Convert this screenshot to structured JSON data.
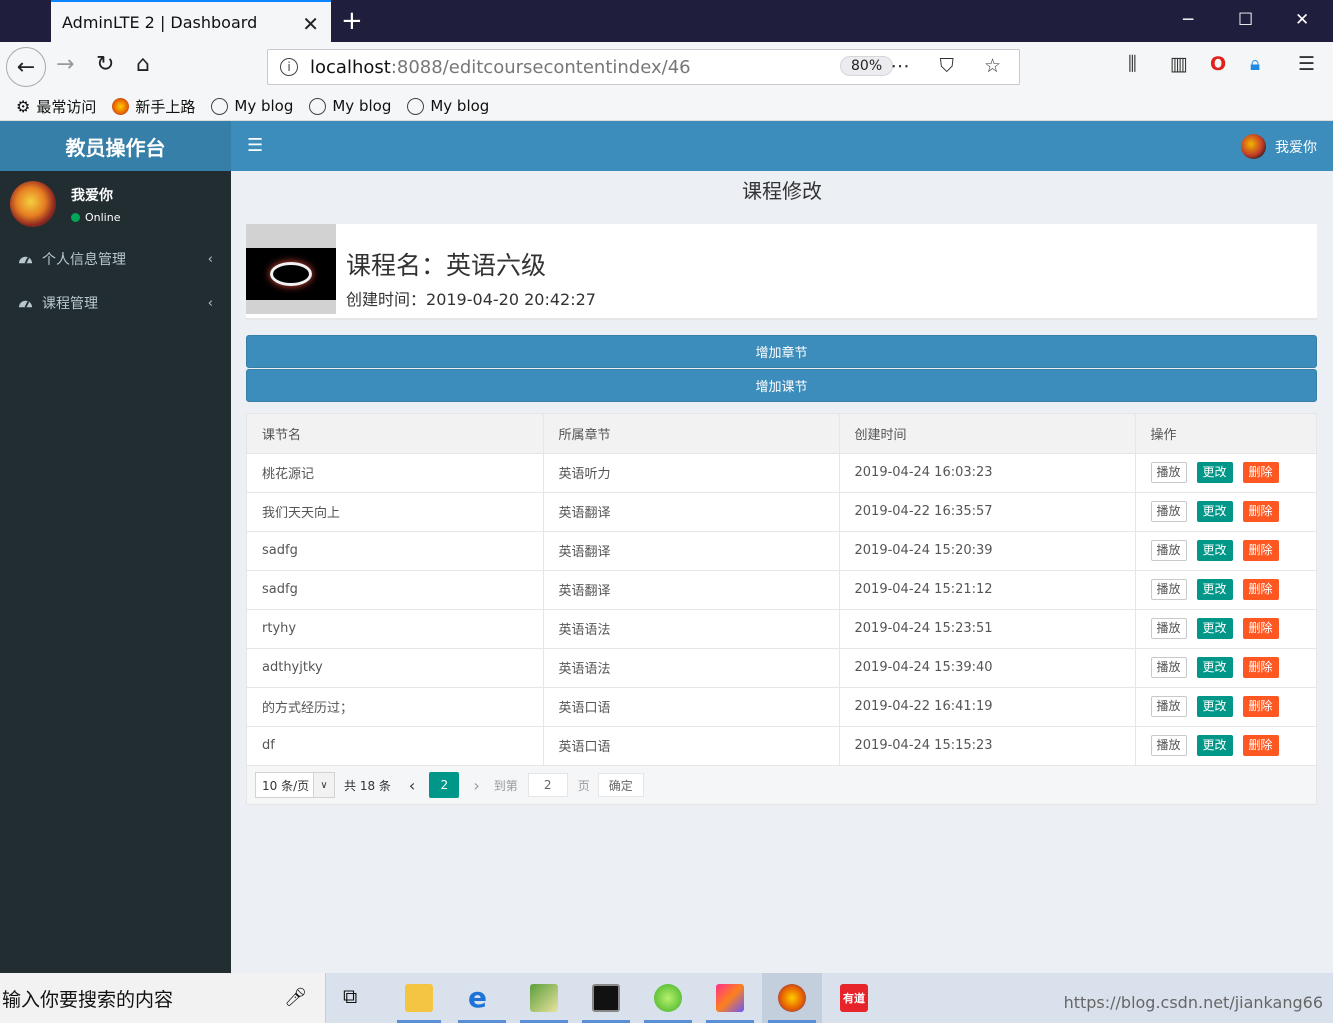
{
  "browser": {
    "tab_title": "AdminLTE 2 | Dashboard",
    "url_host": "localhost",
    "url_path": ":8088/editcoursecontentindex/46",
    "zoom": "80%",
    "bookmarks": [
      "最常访问",
      "新手上路",
      "My blog",
      "My blog",
      "My blog"
    ]
  },
  "app": {
    "logo": "教员操作台",
    "header_user": "我爱你",
    "sidebar": {
      "user_name": "我爱你",
      "status": "Online",
      "items": [
        {
          "label": "个人信息管理"
        },
        {
          "label": "课程管理"
        }
      ]
    },
    "page_title": "课程修改",
    "course": {
      "name": "课程名：英语六级",
      "created_label": "创建时间：",
      "created_value": "2019-04-20 20:42:27"
    },
    "buttons": {
      "add_chapter": "增加章节",
      "add_lesson": "增加课节"
    },
    "table": {
      "headers": [
        "课节名",
        "所属章节",
        "创建时间",
        "操作"
      ],
      "rows": [
        {
          "name": "桃花源记",
          "chapter": "英语听力",
          "time": "2019-04-24 16:03:23"
        },
        {
          "name": "我们天天向上",
          "chapter": "英语翻译",
          "time": "2019-04-22 16:35:57"
        },
        {
          "name": "sadfg",
          "chapter": "英语翻译",
          "time": "2019-04-24 15:20:39"
        },
        {
          "name": "sadfg",
          "chapter": "英语翻译",
          "time": "2019-04-24 15:21:12"
        },
        {
          "name": "rtyhy",
          "chapter": "英语语法",
          "time": "2019-04-24 15:23:51"
        },
        {
          "name": "adthyjtky",
          "chapter": "英语语法",
          "time": "2019-04-24 15:39:40"
        },
        {
          "name": "的方式经历过；",
          "chapter": "英语口语",
          "time": "2019-04-22 16:41:19"
        },
        {
          "name": "df",
          "chapter": "英语口语",
          "time": "2019-04-24 15:15:23"
        }
      ],
      "actions": {
        "play": "播放",
        "edit": "更改",
        "delete": "删除"
      }
    },
    "pager": {
      "limit": "10 条/页",
      "total": "共 18 条",
      "current": "2",
      "goto_label": "到第",
      "goto_value": "2",
      "page_label": "页",
      "confirm": "确定"
    }
  },
  "taskbar": {
    "search_placeholder": "输入你要搜索的内容",
    "watermark": "https://blog.csdn.net/jiankang66"
  },
  "colors": {
    "header": "#3c8dbc",
    "logo_bg": "#367fa9",
    "sidebar": "#222d32",
    "edit": "#009688",
    "delete": "#ff5722"
  }
}
